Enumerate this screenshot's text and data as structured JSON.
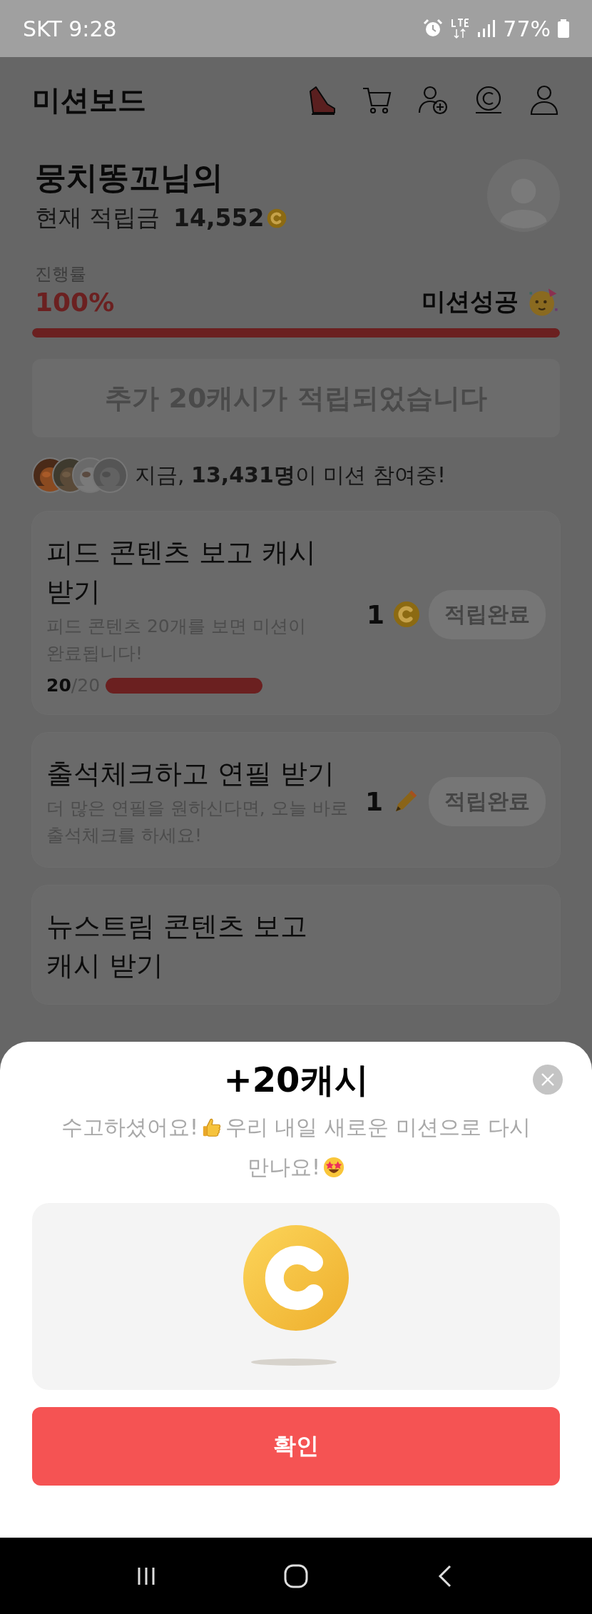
{
  "status_bar": {
    "carrier_time": "SKT 9:28",
    "battery": "77%"
  },
  "header": {
    "title": "미션보드"
  },
  "profile": {
    "name": "뭉치똥꼬님의",
    "balance_label": "현재 적립금",
    "balance": "14,552"
  },
  "progress": {
    "label": "진행률",
    "percent": "100%",
    "level": 1,
    "result": "미션성공"
  },
  "banner": {
    "text": "추가 20캐시가 적립되었습니다"
  },
  "participants": {
    "prefix": "지금,",
    "count": "13,431명",
    "suffix": "이 미션 참여중!"
  },
  "missions": [
    {
      "title": "피드 콘텐츠 보고 캐시 받기",
      "description": "피드 콘텐츠 20개를 보면 미션이 완료됩니다!",
      "reward": "1",
      "kind": "coin",
      "button": "적립완료",
      "count": "20",
      "total": "/20",
      "level": 1
    },
    {
      "title": "출석체크하고 연필 받기",
      "description": "더 많은 연필을 원하신다면, 오늘 바로 출석체크를 하세요!",
      "reward": "1",
      "kind": "pencil",
      "button": "적립완료"
    },
    {
      "title": "뉴스트림 콘텐츠 보고 캐시 받기"
    }
  ],
  "sheet": {
    "title": "+20캐시",
    "message_lines": [
      [
        {
          "text": "수고하셨어요!",
          "kind": "thumbs-up"
        },
        {
          "text": "우리 내일 새로운 미션으로 다시"
        }
      ],
      [
        {
          "text": "만나요!",
          "kind": "star-eyes"
        }
      ]
    ],
    "confirm": "확인"
  }
}
